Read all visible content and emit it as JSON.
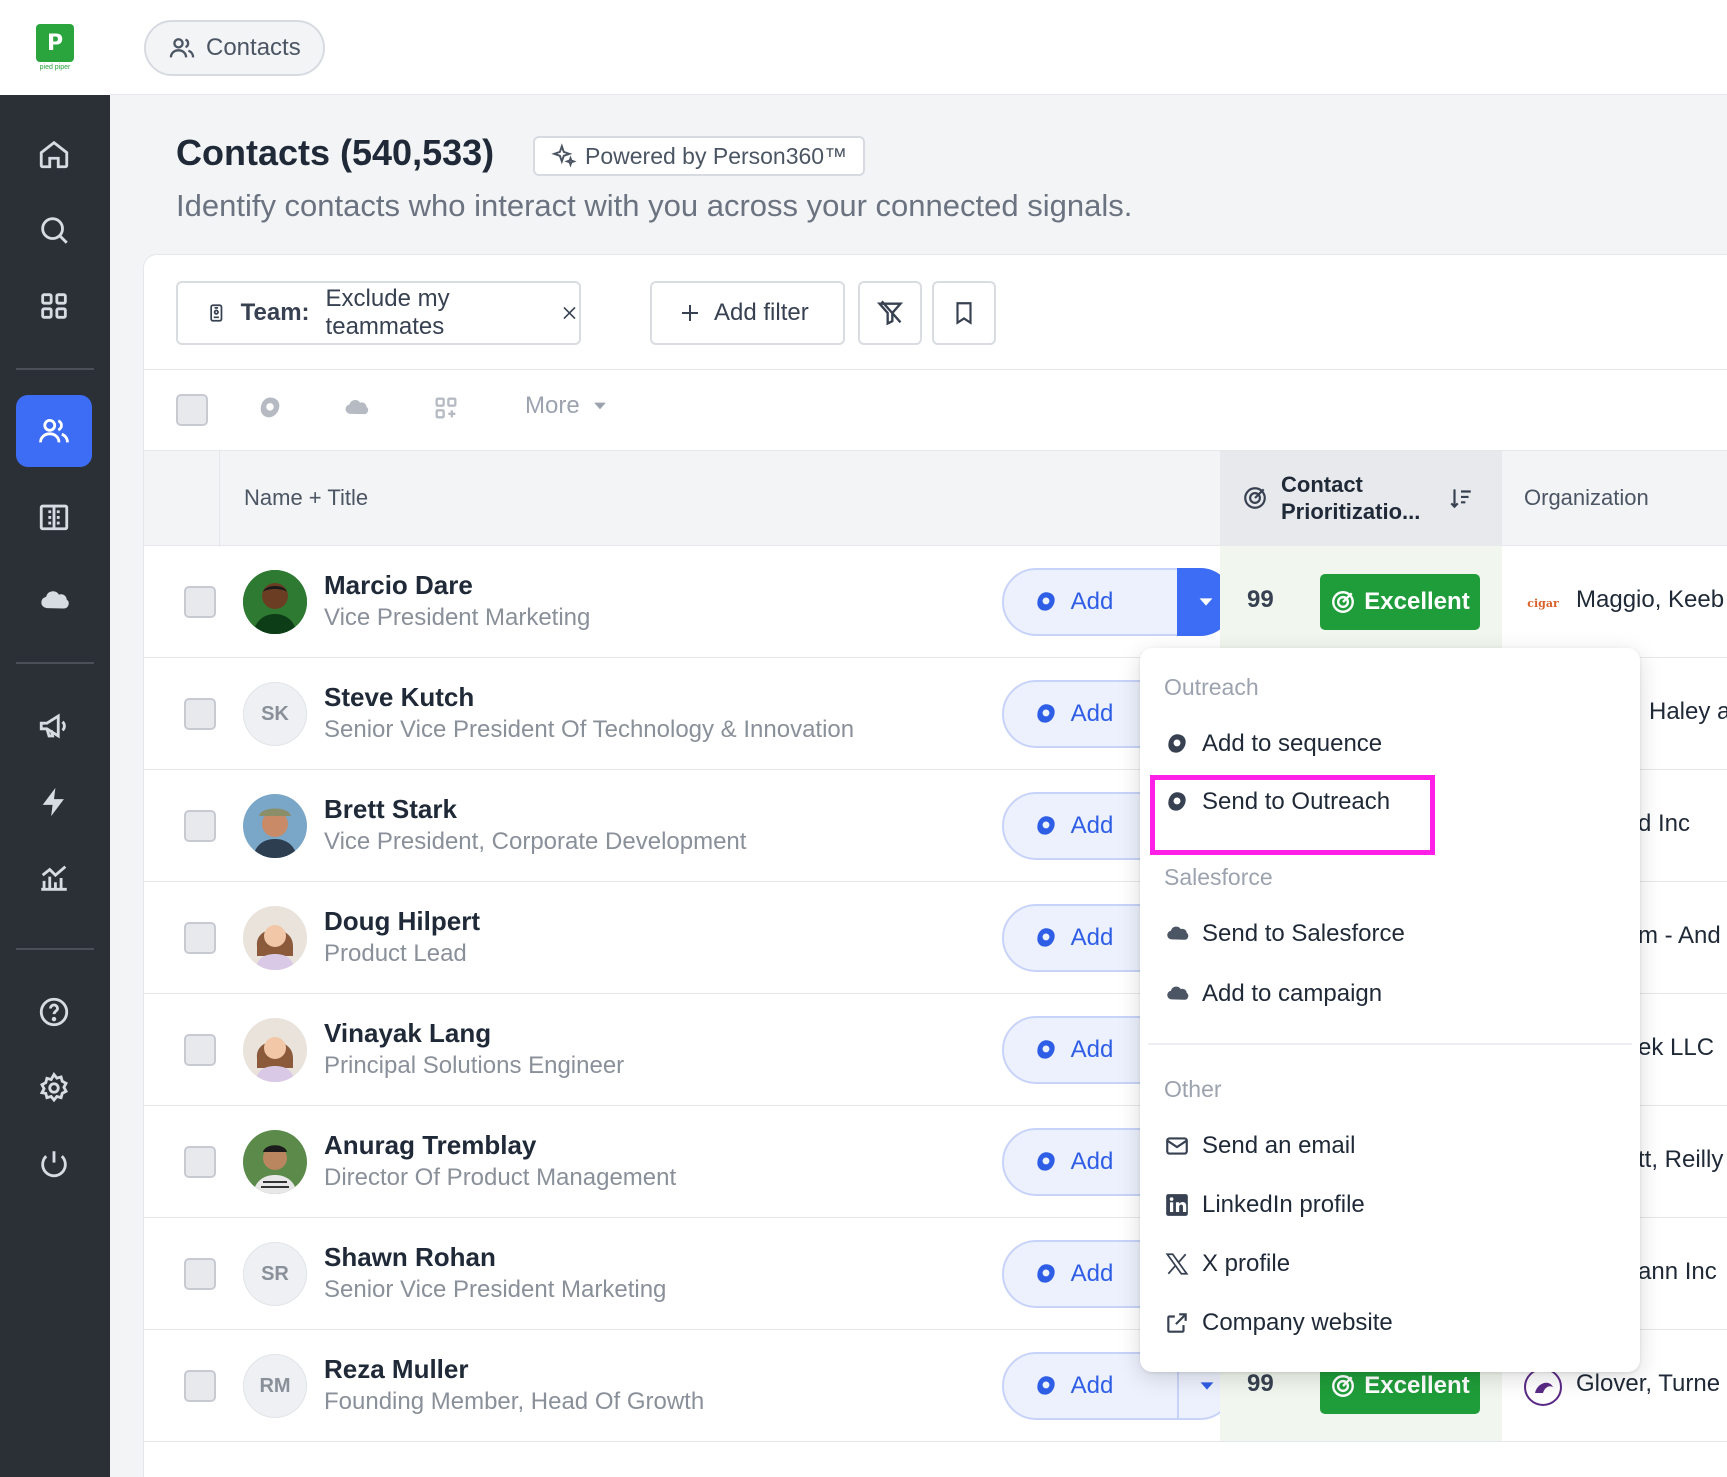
{
  "app": {
    "logo_text": "pied piper"
  },
  "breadcrumb": {
    "label": "Contacts"
  },
  "header": {
    "title": "Contacts (540,533)",
    "powered_by": "Powered by Person360™",
    "subtitle": "Identify contacts who interact with you across your connected signals."
  },
  "filters": {
    "team_label": "Team:",
    "team_value": "Exclude my teammates",
    "add_filter": "Add filter"
  },
  "toolbar": {
    "more": "More"
  },
  "table": {
    "col_name": "Name + Title",
    "col_prio_line1": "Contact",
    "col_prio_line2": "Prioritizatio...",
    "col_org": "Organization",
    "add_label": "Add",
    "rows": [
      {
        "name": "Marcio Dare",
        "title": "Vice President Marketing",
        "initials": "",
        "score": "99",
        "rating": "Excellent",
        "org": "Maggio, Keeb"
      },
      {
        "name": "Steve Kutch",
        "title": "Senior Vice President Of Technology & Innovation",
        "initials": "SK",
        "org": "Haley a"
      },
      {
        "name": "Brett Stark",
        "title": "Vice President, Corporate Development",
        "initials": "",
        "org": "d Inc"
      },
      {
        "name": "Doug Hilpert",
        "title": "Product Lead",
        "initials": "",
        "org": "m - And"
      },
      {
        "name": "Vinayak Lang",
        "title": "Principal Solutions Engineer",
        "initials": "",
        "org": "ek LLC"
      },
      {
        "name": "Anurag Tremblay",
        "title": "Director Of Product Management",
        "initials": "",
        "org": "tt, Reilly"
      },
      {
        "name": "Shawn Rohan",
        "title": "Senior Vice President Marketing",
        "initials": "SR",
        "org": "ann Inc"
      },
      {
        "name": "Reza Muller",
        "title": "Founding Member, Head Of Growth",
        "initials": "RM",
        "score": "99",
        "rating": "Excellent",
        "org": "Glover, Turne"
      }
    ]
  },
  "menu": {
    "group_outreach": "Outreach",
    "add_to_sequence": "Add to sequence",
    "send_to_outreach": "Send to Outreach",
    "group_salesforce": "Salesforce",
    "send_to_salesforce": "Send to Salesforce",
    "add_to_campaign": "Add to campaign",
    "group_other": "Other",
    "send_email": "Send an email",
    "linkedin": "LinkedIn profile",
    "x_profile": "X profile",
    "company_website": "Company website"
  },
  "colors": {
    "accent": "#3d6df5",
    "excellent": "#1f9d3a",
    "highlight": "#ff1fe6",
    "sidebar": "#2b2f36"
  }
}
